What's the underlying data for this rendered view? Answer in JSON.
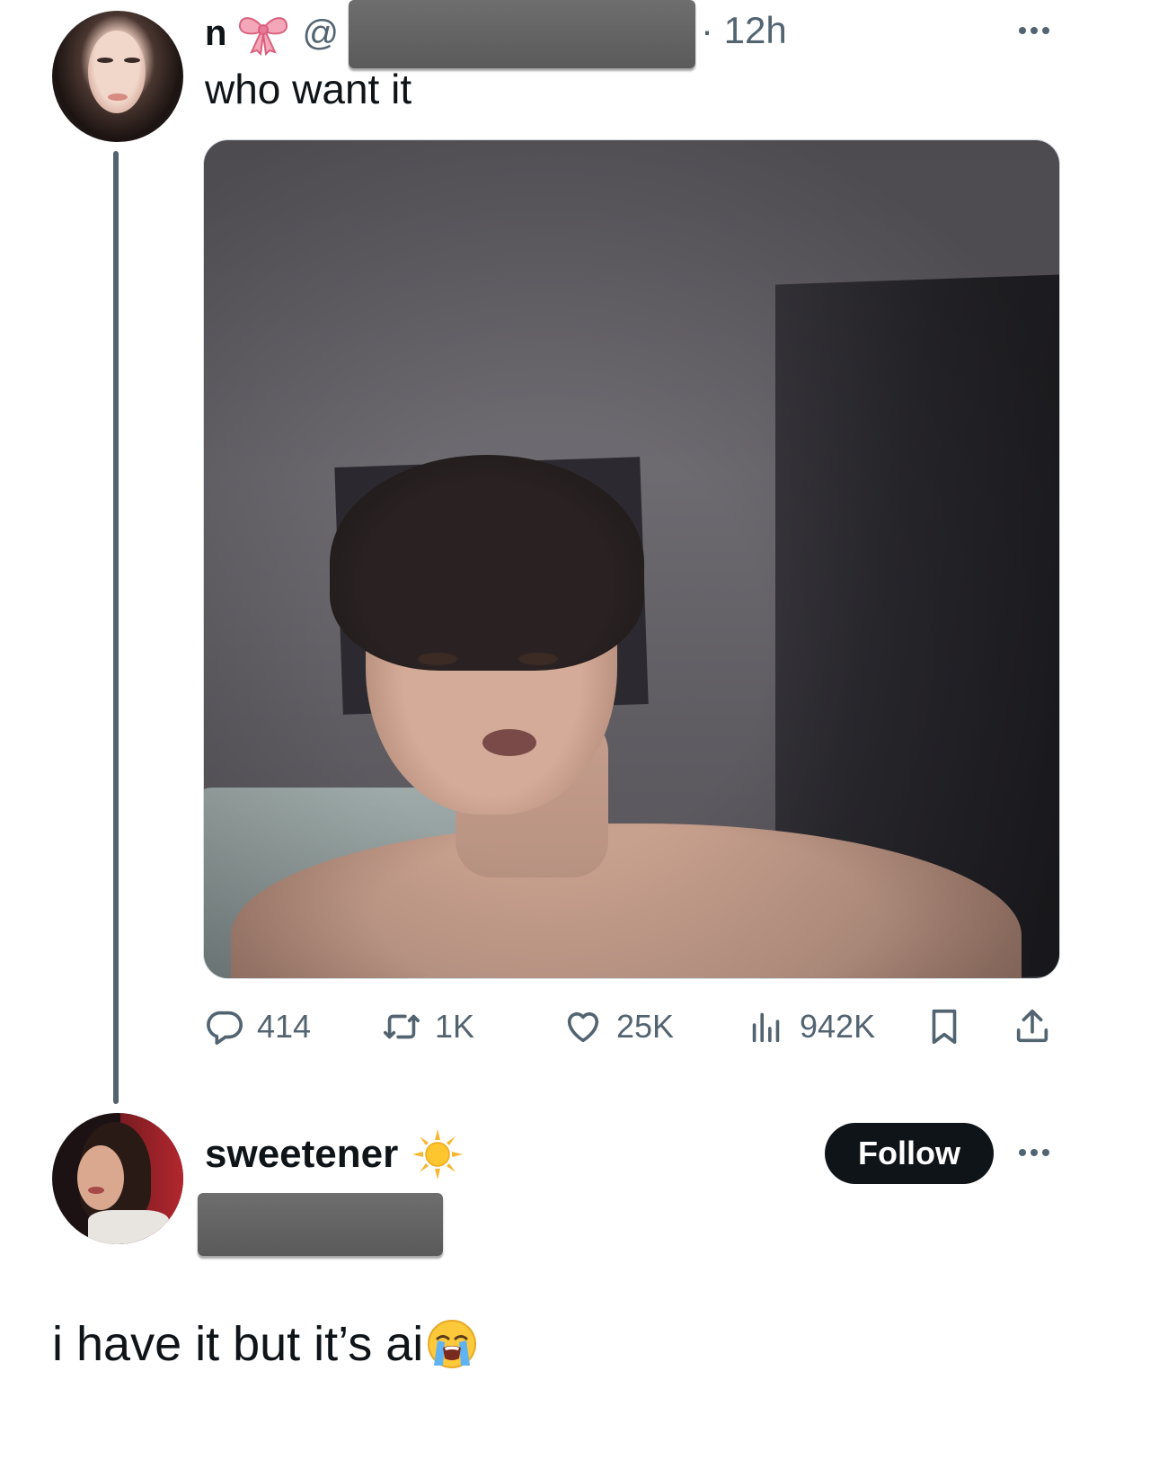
{
  "tweet": {
    "display_name": "n",
    "name_emoji": "ribbon-bow-icon",
    "handle_prefix": "@",
    "time": "· 12h",
    "text": "who want it",
    "media_description_icon": "video-thumbnail",
    "actions": {
      "replies": "414",
      "reposts": "1K",
      "likes": "25K",
      "views": "942K"
    }
  },
  "reply": {
    "display_name": "sweetener",
    "name_emoji": "sun-icon",
    "follow_label": "Follow",
    "text": "i have it but it’s  ai",
    "text_emoji": "loudly-crying-face-icon"
  },
  "colors": {
    "text_primary": "#0f1419",
    "text_secondary": "#536471",
    "follow_bg": "#0f1419",
    "redaction": "#666666"
  }
}
